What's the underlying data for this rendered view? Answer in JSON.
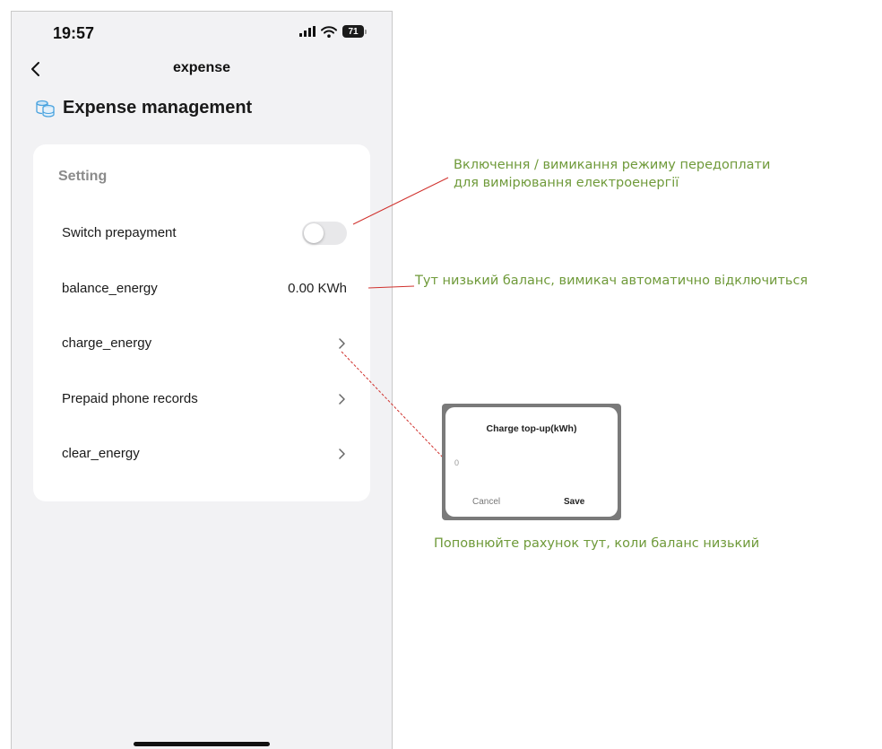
{
  "status_bar": {
    "time": "19:57",
    "battery": "71"
  },
  "nav": {
    "title": "expense"
  },
  "section": {
    "title": "Expense management"
  },
  "card": {
    "title": "Setting",
    "rows": [
      {
        "label": "Switch prepayment",
        "type": "toggle",
        "on": false
      },
      {
        "label": "balance_energy",
        "type": "value",
        "value": "0.00 KWh"
      },
      {
        "label": "charge_energy",
        "type": "link"
      },
      {
        "label": "Prepaid phone records",
        "type": "link"
      },
      {
        "label": "clear_energy",
        "type": "link"
      }
    ]
  },
  "annotations": {
    "prepayment_note": {
      "line1": "Включення / вимикання режиму передоплати",
      "line2": "для вимірювання електроенергії"
    },
    "balance_note": "Тут низький баланс, вимикач автоматично відключиться",
    "topup_note": "Поповнюйте рахунок тут, коли баланс низький"
  },
  "dialog": {
    "title": "Charge top-up(kWh)",
    "input_placeholder": "0",
    "cancel_label": "Cancel",
    "save_label": "Save"
  },
  "colors": {
    "annotation_text": "#6f9a3a",
    "annotation_line": "#d0312d",
    "toggle_off": "#e8e8ea",
    "icon_accent": "#4aa3df"
  }
}
